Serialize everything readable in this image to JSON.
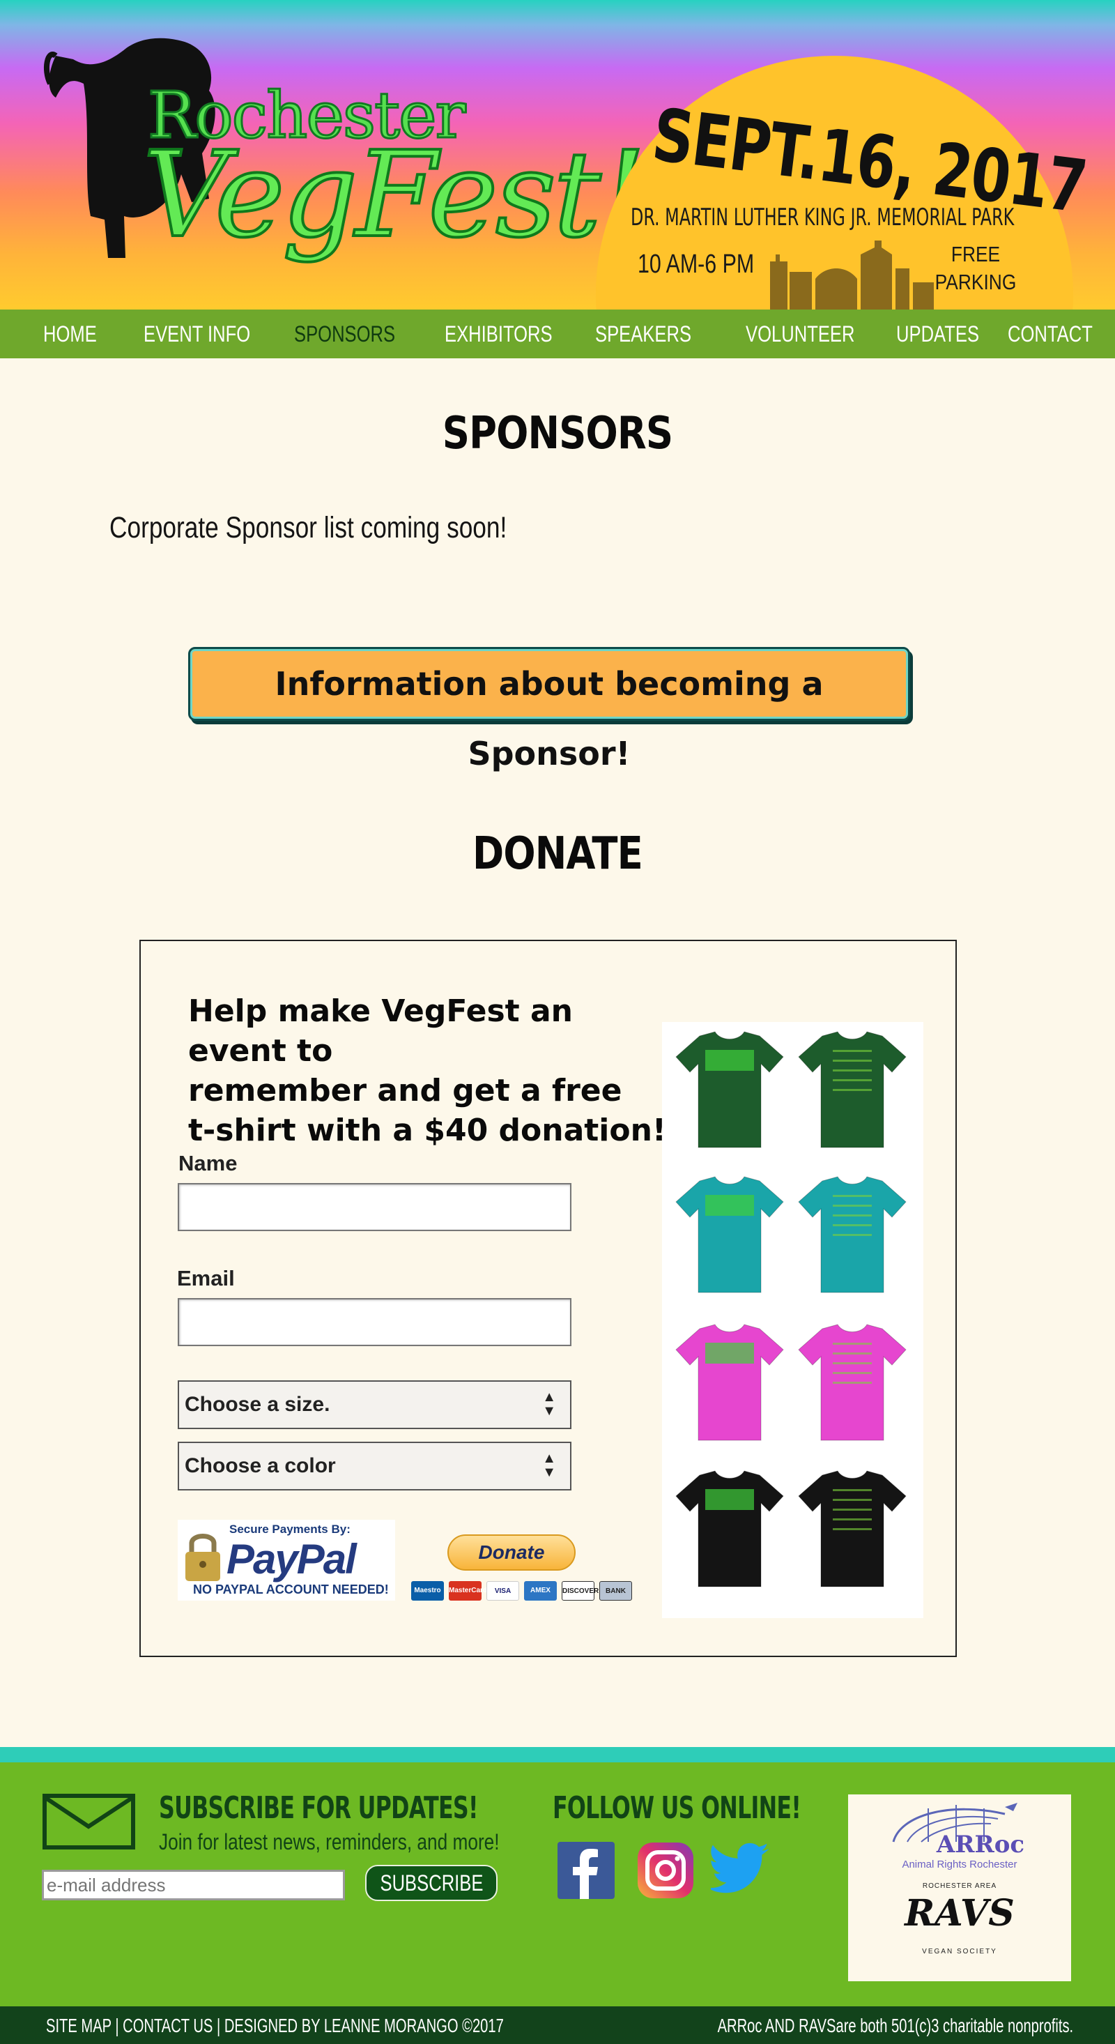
{
  "header": {
    "logo_line1": "Rochester",
    "logo_line2": "VegFest!",
    "date": "SEPT.16, 2017",
    "location": "DR. MARTIN LUTHER KING JR. MEMORIAL PARK",
    "hours": "10 AM-6 PM",
    "parking_line1": "FREE",
    "parking_line2": "PARKING"
  },
  "nav": {
    "items": [
      {
        "label": "HOME"
      },
      {
        "label": "EVENT INFO"
      },
      {
        "label": "SPONSORS",
        "active": true
      },
      {
        "label": "EXHIBITORS"
      },
      {
        "label": "SPEAKERS"
      },
      {
        "label": "VOLUNTEER"
      },
      {
        "label": "UPDATES"
      },
      {
        "label": "CONTACT"
      }
    ]
  },
  "sponsors": {
    "heading": "SPONSORS",
    "note": "Corporate Sponsor list coming soon!",
    "button_label": "Information about becoming a Sponsor!"
  },
  "donate": {
    "heading": "DONATE",
    "message_line1": "Help make VegFest an event to",
    "message_line2": "remember and get a free",
    "message_line3": "t-shirt with a $40 donation!",
    "name_label": "Name",
    "name_value": "",
    "email_label": "Email",
    "email_value": "",
    "size_select": "Choose a size.",
    "color_select": "Choose a color",
    "paypal": {
      "secure": "Secure Payments By:",
      "logo": "PayPal",
      "no_account": "NO PAYPAL ACCOUNT NEEDED!"
    },
    "donate_button": "Donate",
    "cards": [
      "Maestro",
      "MasterCard",
      "VISA",
      "AMEX",
      "DISCOVER",
      "BANK"
    ],
    "shirt_colors": [
      "#1d5c2c",
      "#1aa5a9",
      "#e646cf",
      "#141414"
    ]
  },
  "footer": {
    "subscribe_title": "SUBSCRIBE FOR UPDATES!",
    "subscribe_text": "Join for latest news, reminders, and more!",
    "email_placeholder": "e-mail address",
    "subscribe_button": "SUBSCRIBE",
    "follow_title": "FOLLOW US ONLINE!",
    "social": [
      "facebook",
      "instagram",
      "twitter"
    ],
    "partner1_name": "ARRoc",
    "partner1_sub": "Animal Rights Rochester",
    "partner2_top": "ROCHESTER AREA",
    "partner2_name": "RAVS",
    "partner2_bottom": "VEGAN SOCIETY"
  },
  "bottom": {
    "site_map": "SITE MAP",
    "contact": "CONTACT US",
    "designed": "DESIGNED BY LEANNE MORANGO ©2017",
    "nonprofit": "ARRoc AND RAVSare both 501(c)3 charitable nonprofits."
  },
  "colors": {
    "nav_bg": "#6fa82c",
    "footer_bg": "#6db923",
    "accent_button": "#fbb24b",
    "page_bg": "#fdf8ea"
  }
}
